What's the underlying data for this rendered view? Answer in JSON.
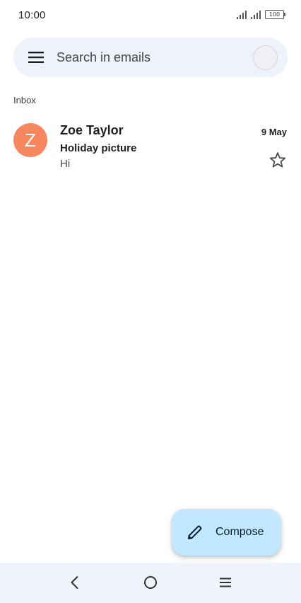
{
  "status_bar": {
    "time": "10:00",
    "battery": "100"
  },
  "search": {
    "placeholder": "Search in emails"
  },
  "section": {
    "label": "Inbox"
  },
  "emails": [
    {
      "avatar_letter": "Z",
      "avatar_color": "#f7875e",
      "sender": "Zoe Taylor",
      "date": "9 May",
      "subject": "Holiday picture",
      "snippet": "Hi",
      "starred": false
    }
  ],
  "compose": {
    "label": "Compose",
    "icon": "pencil-icon",
    "background": "#c2e7ff"
  },
  "nav": {
    "icons": [
      "back-icon",
      "home-icon",
      "recents-icon"
    ]
  }
}
